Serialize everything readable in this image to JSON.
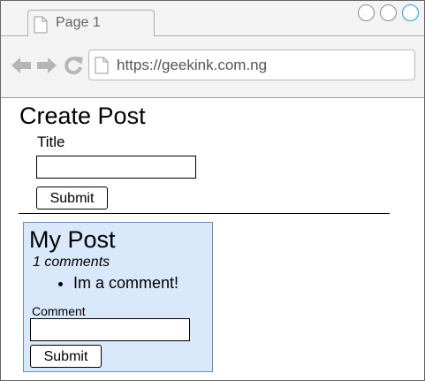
{
  "browser": {
    "tab_label": "Page 1",
    "url": "https://geekink.com.ng",
    "colors": {
      "chrome_bg": "#f3f3f3",
      "active_circle": "#1ba1e2"
    }
  },
  "create_post": {
    "heading": "Create Post",
    "title_label": "Title",
    "title_value": "",
    "submit_label": "Submit"
  },
  "post": {
    "title": "My Post",
    "comment_count": "1 comments",
    "comments": [
      "Im a comment!"
    ],
    "comment_label": "Comment",
    "comment_value": "",
    "submit_label": "Submit",
    "colors": {
      "card_bg": "#dae8fc",
      "card_border": "#6c8ebf"
    }
  }
}
